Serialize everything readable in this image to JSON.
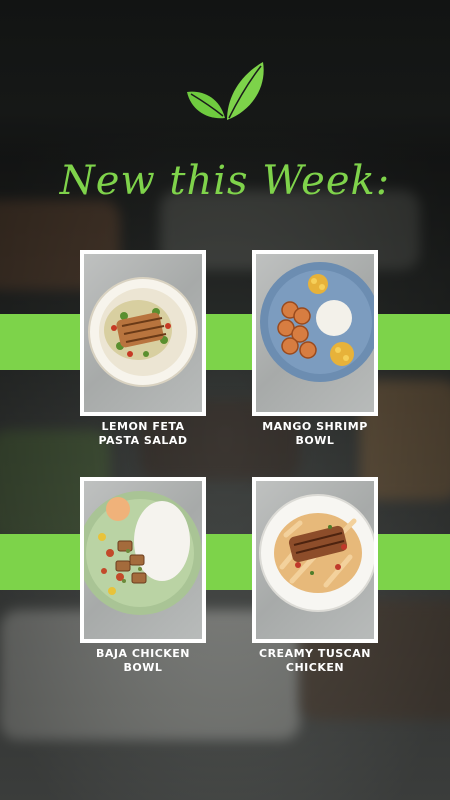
{
  "brand": {
    "icon": "leaf-icon",
    "accent": "#7dd34a"
  },
  "headline": "New this Week:",
  "meals": [
    {
      "name": "LEMON FETA\nPASTA SALAD",
      "line1": "LEMON FETA",
      "line2": "PASTA SALAD"
    },
    {
      "name": "MANGO SHRIMP\nBOWL",
      "line1": "MANGO SHRIMP",
      "line2": "BOWL"
    },
    {
      "name": "BAJA CHICKEN\nBOWL",
      "line1": "BAJA CHICKEN",
      "line2": "BOWL"
    },
    {
      "name": "CREAMY TUSCAN\nCHICKEN",
      "line1": "CREAMY TUSCAN",
      "line2": "CHICKEN"
    }
  ]
}
